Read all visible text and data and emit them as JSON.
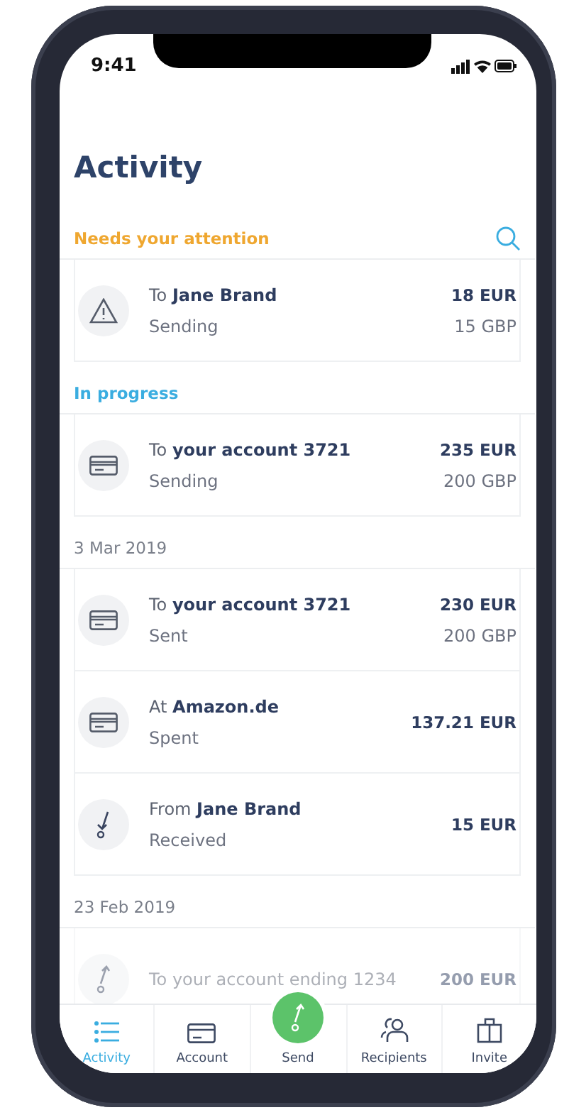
{
  "status_bar": {
    "time": "9:41"
  },
  "title": "Activity",
  "sections": [
    {
      "kind": "attention",
      "heading": "Needs your attention",
      "rows": [
        {
          "kind": "warning",
          "title": "To **Jane Brand**",
          "status": "Sending",
          "amount": "18 EUR",
          "secondary": "15 GBP",
          "faded": false
        }
      ]
    },
    {
      "kind": "progress",
      "heading": "In progress",
      "rows": [
        {
          "kind": "card",
          "title": "To **your account 3721**",
          "status": "Sending",
          "amount": "235 EUR",
          "secondary": "200 GBP",
          "faded": false
        }
      ]
    },
    {
      "kind": "date",
      "heading": "3 Mar 2019",
      "rows": [
        {
          "kind": "card",
          "title": "To **your account 3721**",
          "status": "Sent",
          "amount": "230 EUR",
          "secondary": "200 GBP",
          "faded": false
        },
        {
          "kind": "card",
          "title": "At **Amazon.de**",
          "status": "Spent",
          "amount": "137.21 EUR",
          "faded": false
        },
        {
          "kind": "receive",
          "title": "From **Jane Brand**",
          "status": "Received",
          "amount": "15 EUR",
          "faded": false
        }
      ]
    },
    {
      "kind": "date",
      "heading": "23 Feb 2019",
      "rows": [
        {
          "kind": "send",
          "title": "To your account ending 1234",
          "amount": "200 EUR",
          "faded": true
        }
      ]
    }
  ],
  "tab_bar": [
    {
      "kind": "list",
      "label": "Activity",
      "selected": true
    },
    {
      "kind": "card",
      "label": "Account",
      "selected": false
    },
    {
      "kind": "send",
      "label": "Send",
      "selected": false
    },
    {
      "kind": "people",
      "label": "Recipients",
      "selected": false
    },
    {
      "kind": "gift",
      "label": "Invite",
      "selected": false
    }
  ]
}
